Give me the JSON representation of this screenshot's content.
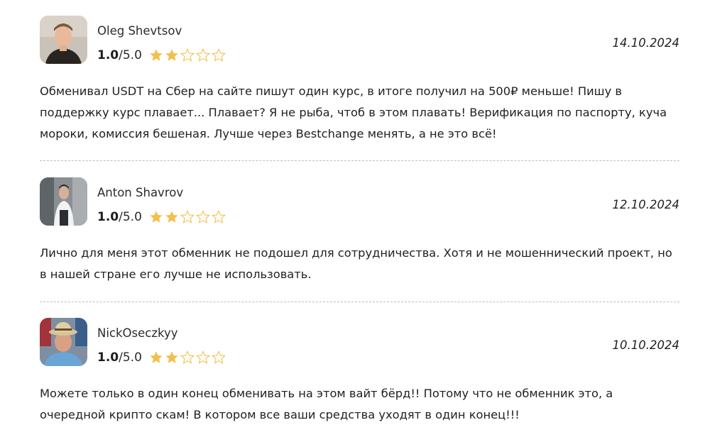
{
  "reviews": [
    {
      "author": "Oleg Shevtsov",
      "rating": "1.0",
      "rating_max": "/5.0",
      "stars_filled": 2,
      "stars_total": 5,
      "date": "14.10.2024",
      "text": "Обменивал USDT на Сбер на сайте пишут один курс, в итоге получил на 500₽ меньше! Пишу в поддержку курс плавает... Плавает? Я не рыба, чтоб в этом плавать! Верификация по паспорту, куча мороки, комиссия бешеная. Лучше через Bestchange менять, а не это всё!"
    },
    {
      "author": "Anton Shavrov",
      "rating": "1.0",
      "rating_max": "/5.0",
      "stars_filled": 2,
      "stars_total": 5,
      "date": "12.10.2024",
      "text": "Лично для меня этот обменник не подошел для сотрудничества. Хотя и не мошеннический проект, но в нашей стране его лучше не использовать."
    },
    {
      "author": "NickOseczkyy",
      "rating": "1.0",
      "rating_max": "/5.0",
      "stars_filled": 2,
      "stars_total": 5,
      "date": "10.10.2024",
      "text": "Можете только в один конец обменивать на этом вайт бёрд!! Потому что не обменник это, а очередной крипто скам! В котором все ваши средства уходят в один конец!!!"
    }
  ],
  "colors": {
    "star_filled": "#f2c04b",
    "star_empty_stroke": "#f2c04b",
    "divider": "#bdbdbd"
  }
}
